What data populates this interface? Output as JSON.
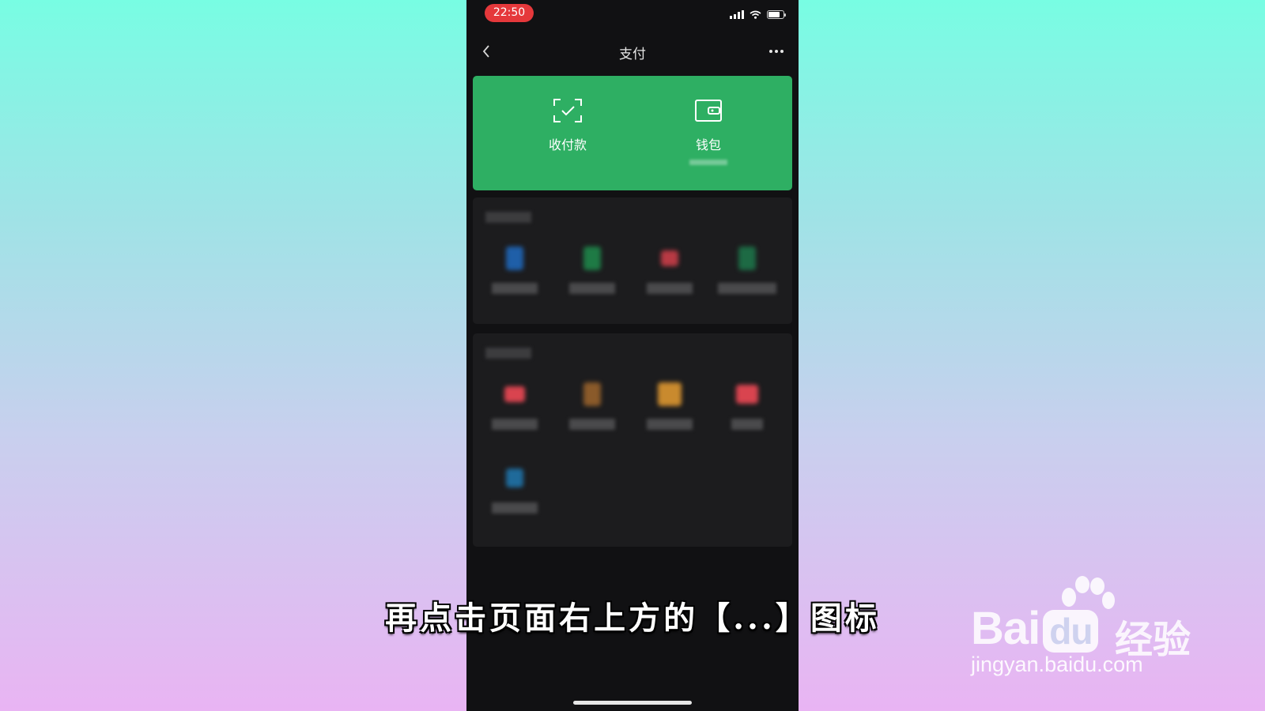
{
  "status_bar": {
    "time": "22:50"
  },
  "nav": {
    "title": "支付"
  },
  "green_card": {
    "items": [
      {
        "label": "收付款",
        "icon": "scan-check-icon"
      },
      {
        "label": "钱包",
        "icon": "wallet-icon"
      }
    ]
  },
  "sections": [
    {
      "services": [
        {
          "icon_color": "#1f5fa8"
        },
        {
          "icon_color": "#1e7a45"
        },
        {
          "icon_color": "#b83a44"
        },
        {
          "icon_color": "#1d6a44"
        }
      ]
    },
    {
      "services": [
        {
          "icon_color": "#d9444f"
        },
        {
          "icon_color": "#8a5a2a"
        },
        {
          "icon_color": "#c98a2e"
        },
        {
          "icon_color": "#d9444f"
        },
        {
          "icon_color": "#1f6a9a"
        }
      ]
    }
  ],
  "caption": "再点击页面右上方的【...】图标",
  "watermark": {
    "brand": "Bai",
    "brand_cn": "经验",
    "url": "jingyan.baidu.com"
  },
  "colors": {
    "green": "#2eaf63",
    "background_dark": "#111113"
  }
}
